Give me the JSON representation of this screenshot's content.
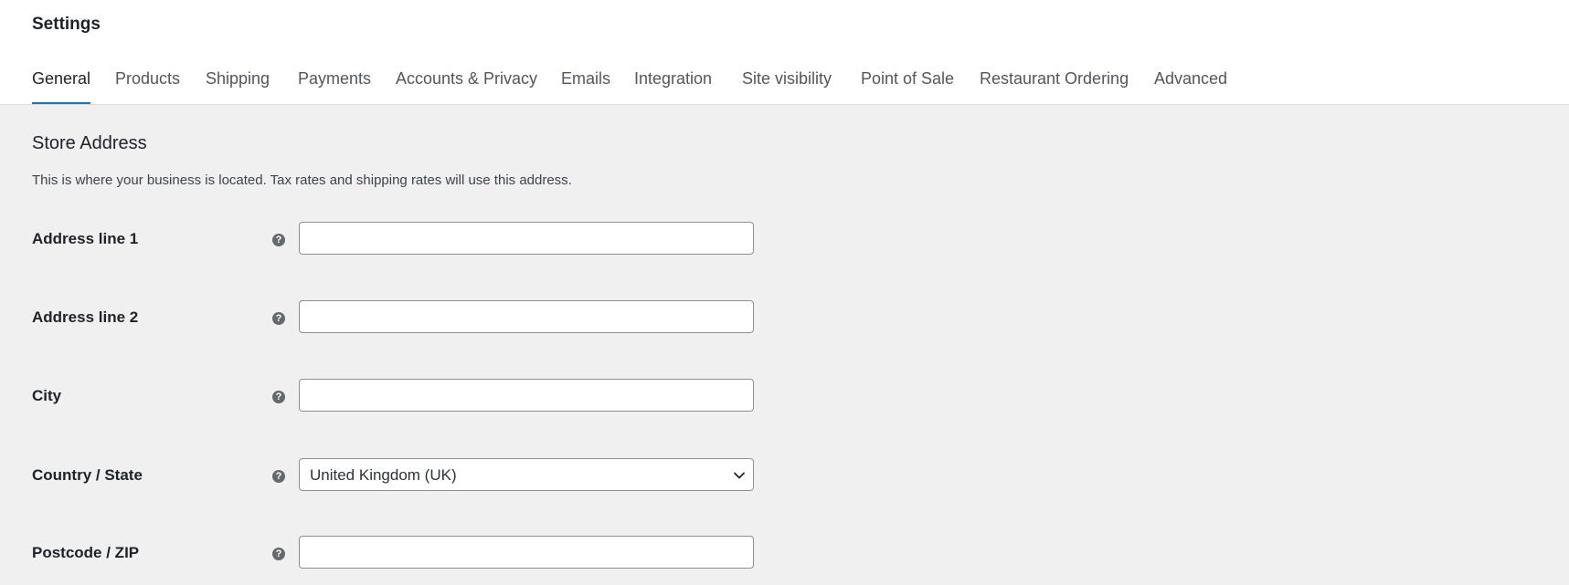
{
  "page": {
    "title": "Settings"
  },
  "tabs": [
    {
      "label": "General",
      "active": true
    },
    {
      "label": "Products"
    },
    {
      "label": "Shipping"
    },
    {
      "label": "Payments"
    },
    {
      "label": "Accounts & Privacy"
    },
    {
      "label": "Emails"
    },
    {
      "label": "Integration"
    },
    {
      "label": "Site visibility"
    },
    {
      "label": "Point of Sale"
    },
    {
      "label": "Restaurant Ordering"
    },
    {
      "label": "Advanced"
    }
  ],
  "section": {
    "title": "Store Address",
    "description": "This is where your business is located. Tax rates and shipping rates will use this address."
  },
  "fields": {
    "address1": {
      "label": "Address line 1",
      "value": "",
      "placeholder": ""
    },
    "address2": {
      "label": "Address line 2",
      "value": "",
      "placeholder": ""
    },
    "city": {
      "label": "City",
      "value": "",
      "placeholder": ""
    },
    "country": {
      "label": "Country / State",
      "selected": "United Kingdom (UK)"
    },
    "postcode": {
      "label": "Postcode / ZIP",
      "value": "",
      "placeholder": ""
    }
  },
  "icons": {
    "help": "help-icon",
    "dropdown": "chevron-down-icon"
  },
  "colors": {
    "accent": "#2271b1",
    "background": "#f0f0f1",
    "header": "#ffffff"
  }
}
